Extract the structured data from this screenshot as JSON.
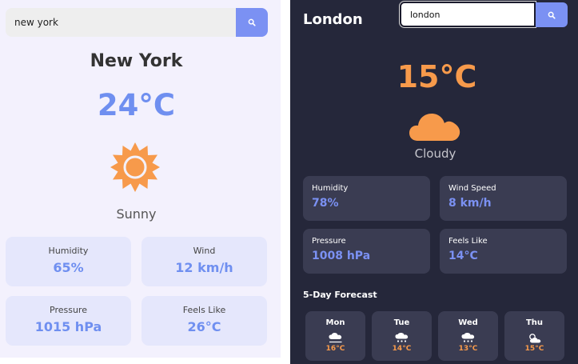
{
  "left": {
    "search": {
      "value": "new york"
    },
    "city": "New York",
    "temperature": "24°C",
    "condition": "Sunny",
    "condition_icon": "sun-icon",
    "stats": [
      {
        "label": "Humidity",
        "value": "65%"
      },
      {
        "label": "Wind",
        "value": "12 km/h"
      },
      {
        "label": "Pressure",
        "value": "1015 hPa"
      },
      {
        "label": "Feels Like",
        "value": "26°C"
      }
    ]
  },
  "right": {
    "city": "London",
    "search": {
      "value": "london"
    },
    "temperature": "15°C",
    "condition": "Cloudy",
    "condition_icon": "cloud-icon",
    "stats": [
      {
        "label": "Humidity",
        "value": "78%"
      },
      {
        "label": "Wind Speed",
        "value": "8 km/h"
      },
      {
        "label": "Pressure",
        "value": "1008 hPa"
      },
      {
        "label": "Feels Like",
        "value": "14°C"
      }
    ],
    "forecast_title": "5-Day Forecast",
    "forecast": [
      {
        "day": "Mon",
        "temp": "16°C",
        "icon": "rain-cloud-icon"
      },
      {
        "day": "Tue",
        "temp": "14°C",
        "icon": "snow-cloud-icon"
      },
      {
        "day": "Wed",
        "temp": "13°C",
        "icon": "snow-cloud-icon"
      },
      {
        "day": "Thu",
        "temp": "15°C",
        "icon": "partly-cloudy-icon"
      }
    ]
  },
  "colors": {
    "accent": "#7b91f3",
    "temperature_warm": "#f79a4b",
    "light_bg": "#f3f1fd",
    "dark_bg": "#25273a"
  }
}
